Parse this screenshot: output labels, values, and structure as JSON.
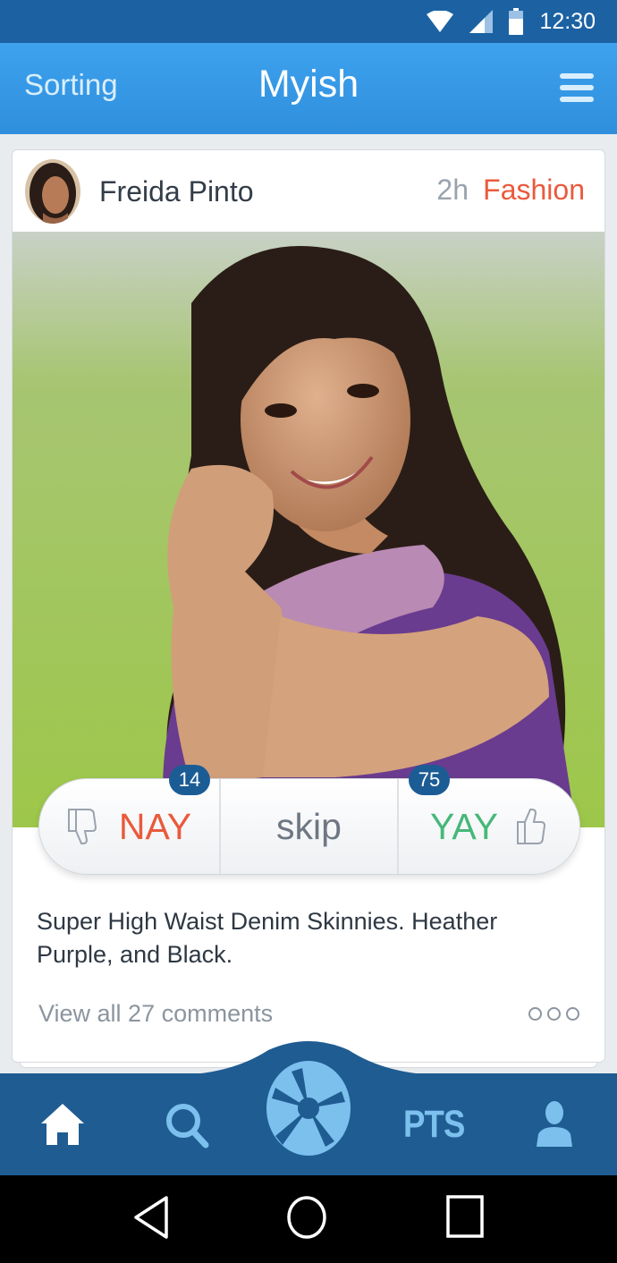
{
  "status_bar": {
    "time": "12:30",
    "icons": [
      "wifi-icon",
      "signal-icon",
      "battery-icon"
    ]
  },
  "app_bar": {
    "left_action": "Sorting",
    "title": "Myish",
    "menu_icon": "hamburger-menu-icon"
  },
  "post": {
    "author": "Freida Pinto",
    "time_ago": "2h",
    "category": "Fashion",
    "description": "Super High Waist Denim Skinnies. Heather Purple, and Black.",
    "view_comments": "View all 27 comments",
    "vote": {
      "nay_label": "NAY",
      "nay_count": "14",
      "skip_label": "skip",
      "yay_label": "YAY",
      "yay_count": "75"
    }
  },
  "bottom_nav": {
    "items": [
      "home-icon",
      "search-icon",
      "camera-shutter-icon",
      "PTS",
      "profile-icon"
    ],
    "pts_label": "PTS"
  },
  "colors": {
    "status_bar": "#1c62a3",
    "app_bar": "#3a9be9",
    "accent_red": "#ea5a3c",
    "accent_green": "#46b879",
    "nav_blue": "#1f5c92",
    "nav_icon": "#7cc0ee"
  }
}
